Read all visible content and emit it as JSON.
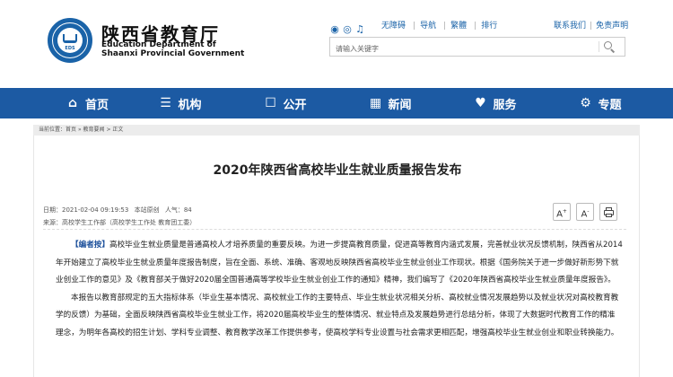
{
  "header": {
    "title_cn": "陕西省教育厅",
    "title_en_1": "Education Department of",
    "title_en_2": "Shaanxi Provincial Government",
    "logo_text": "EDS",
    "top_links": [
      "无障碍",
      "导航",
      "繁體",
      "排行"
    ],
    "right_links": [
      "联系我们",
      "免责声明"
    ],
    "social_icons": [
      "wechat-icon",
      "weibo-icon",
      "tiktok-icon"
    ],
    "search": {
      "placeholder": "请输入关键字",
      "value": ""
    }
  },
  "nav": {
    "items": [
      {
        "label": "首页",
        "icon": "home-icon"
      },
      {
        "label": "机构",
        "icon": "org-icon"
      },
      {
        "label": "公开",
        "icon": "open-icon"
      },
      {
        "label": "新闻",
        "icon": "news-icon"
      },
      {
        "label": "服务",
        "icon": "service-icon"
      },
      {
        "label": "专题",
        "icon": "topic-icon"
      }
    ]
  },
  "breadcrumb": {
    "prefix": "当前位置：",
    "items": [
      "首页",
      "教育要闻",
      "正文"
    ],
    "separator": " » ",
    "tail_separator": " > "
  },
  "article": {
    "title": "2020年陕西省高校毕业生就业质量报告发布",
    "date": "日期：2021-02-04 09:19:53",
    "site": "本站原创",
    "views": "人气：84",
    "source": "来源：高校学生工作部（高校学生工作处 教育团工委）",
    "tools": {
      "font_large": "A",
      "font_small": "A"
    },
    "paragraphs": [
      {
        "tag": "【编者按】",
        "text": "高校毕业生就业质量是普通高校人才培养质量的重要反映。为进一步提高教育质量，促进高等教育内涵式发展，完善就业状况反馈机制，陕西省从2014年开始建立了高校毕业生就业质量年度报告制度，旨在全面、系统、准确、客观地反映陕西省高校毕业生就业创业工作现状。根据《国务院关于进一步做好新形势下就业创业工作的意见》及《教育部关于做好2020届全国普通高等学校毕业生就业创业工作的通知》精神，我们编写了《2020年陕西省高校毕业生就业质量年度报告》。"
      },
      {
        "tag": "",
        "text": "本报告以教育部规定的五大指标体系（毕业生基本情况、高校就业工作的主要特点、毕业生就业状况相关分析、高校就业情况发展趋势以及就业状况对高校教育教学的反馈）为基础，全面反映陕西省高校毕业生就业工作，将2020届高校毕业生的整体情况、就业特点及发展趋势进行总结分析，体现了大数据时代教育工作的精准理念，为明年各高校的招生计划、学科专业调整、教育教学改革工作提供参考，使高校学科专业设置与社会需求更相匹配，增强高校毕业生就业创业和职业转换能力。"
      }
    ]
  },
  "colors": {
    "primary": "#1c5aa3",
    "link": "#1a63a8",
    "tag": "#1a4e9a"
  }
}
